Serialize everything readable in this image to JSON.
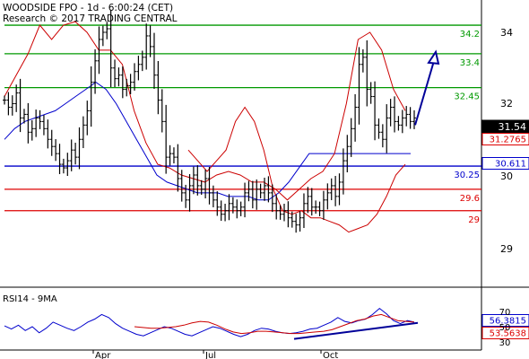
{
  "header": {
    "line1": "WOODSIDE FPO - 1d - 6:00:24 (CET)",
    "line2": "Research © 2017 TRADING CENTRAL"
  },
  "colors": {
    "candle": "#000000",
    "ma": "#0000cc",
    "bollinger": "#cc0000",
    "resistance": "#009900",
    "pivot": "#0000cc",
    "support": "#dd0000",
    "arrow": "#000099",
    "rsi": "#0000cc",
    "rsi_ma": "#cc0000"
  },
  "chart_data": [
    {
      "type": "line",
      "name": "price",
      "yaxis_ticks": [
        "34",
        "32",
        "30",
        "29"
      ],
      "ylim": [
        28.4,
        34.5
      ],
      "xaxis_ticks": [
        "Apr",
        "Jul",
        "Oct"
      ],
      "close": [
        32.1,
        31.9,
        32.0,
        32.3,
        31.6,
        31.7,
        31.2,
        31.3,
        31.6,
        31.5,
        31.3,
        31.0,
        30.8,
        30.6,
        30.3,
        30.2,
        30.4,
        30.7,
        30.5,
        31.0,
        31.4,
        31.8,
        32.6,
        33.2,
        33.8,
        34.0,
        34.1,
        33.0,
        32.7,
        32.8,
        32.4,
        32.5,
        32.6,
        32.9,
        33.1,
        33.3,
        33.9,
        33.6,
        32.8,
        32.1,
        31.5,
        30.5,
        30.6,
        30.5,
        29.9,
        29.5,
        29.3,
        29.7,
        30.0,
        29.7,
        29.6,
        29.9,
        29.5,
        29.3,
        29.1,
        28.9,
        29.0,
        29.2,
        29.1,
        29.0,
        29.1,
        29.5,
        29.6,
        29.3,
        29.6,
        29.5,
        29.7,
        29.5,
        29.2,
        29.0,
        28.9,
        29.0,
        28.8,
        28.7,
        28.6,
        28.8,
        29.2,
        29.4,
        29.1,
        29.1,
        29.0,
        29.3,
        29.5,
        29.7,
        29.4,
        29.8,
        30.4,
        30.8,
        31.3,
        31.9,
        33.1,
        33.3,
        32.4,
        32.2,
        31.4,
        31.2,
        31.0,
        31.6,
        31.9,
        31.5,
        31.4,
        31.6,
        31.7,
        31.5,
        31.6
      ],
      "series": [
        {
          "name": "",
          "values": [
            31.0,
            31.3,
            31.5,
            31.6,
            31.7,
            31.8,
            32.0,
            32.2,
            32.4,
            32.6,
            32.4,
            32.0,
            31.5,
            31.0,
            30.5,
            30.0,
            29.8,
            29.7,
            29.6,
            29.5,
            29.5,
            29.5,
            29.4,
            29.4,
            29.4,
            29.3,
            29.3,
            29.5,
            29.8,
            30.2,
            30.6,
            30.6,
            30.6,
            30.6,
            30.6,
            30.6,
            30.6,
            30.6,
            30.6,
            30.6,
            30.6
          ]
        },
        {
          "name": "",
          "values": [
            32.2,
            32.8,
            33.4,
            34.2,
            33.8,
            34.2,
            34.3,
            34.0,
            33.5,
            33.5,
            33.1,
            31.8,
            30.9,
            30.3,
            30.2,
            30.0,
            29.9,
            29.8,
            30.0,
            30.1,
            30.0,
            29.8,
            29.8,
            29.6,
            29.3,
            29.6,
            29.9,
            30.1,
            30.6,
            32.0,
            33.8,
            34.0,
            33.5,
            32.4,
            31.8
          ]
        },
        {
          "name": "",
          "values": [
            30.7,
            30.4,
            30.1,
            30.4,
            30.7,
            31.5,
            31.9,
            31.5,
            30.7,
            29.6,
            29.0,
            28.9,
            29.0,
            28.8,
            28.8,
            28.7,
            28.6,
            28.4,
            28.5,
            28.6,
            28.9,
            29.4,
            30.0,
            30.3
          ]
        }
      ],
      "levels": [
        {
          "label": "34.2",
          "value": 34.2,
          "kind": "resistance"
        },
        {
          "label": "33.4",
          "value": 33.4,
          "kind": "resistance"
        },
        {
          "label": "32.45",
          "value": 32.45,
          "kind": "resistance"
        },
        {
          "label": "30.25",
          "value": 30.25,
          "kind": "pivot"
        },
        {
          "label": "29.6",
          "value": 29.6,
          "kind": "support"
        },
        {
          "label": "29",
          "value": 29.0,
          "kind": "support"
        }
      ],
      "price_tags": [
        {
          "label": "31.54",
          "value": 31.54,
          "style": "dark"
        },
        {
          "label": "31.2765",
          "value": 31.2765,
          "style": "red"
        },
        {
          "label": "30.611",
          "value": 30.611,
          "style": "blue"
        }
      ],
      "forecast": {
        "from": 31.4,
        "to": 33.4
      }
    },
    {
      "type": "line",
      "title": "RSI14 - 9MA",
      "yaxis_ticks": [
        "70",
        "50",
        "30"
      ],
      "ylim": [
        22,
        80
      ],
      "series": [
        {
          "name": "",
          "values": [
            51,
            47,
            52,
            45,
            50,
            42,
            48,
            56,
            52,
            48,
            45,
            50,
            56,
            60,
            66,
            62,
            54,
            48,
            44,
            40,
            38,
            42,
            46,
            50,
            48,
            44,
            40,
            38,
            42,
            46,
            50,
            48,
            44,
            40,
            37,
            40,
            45,
            48,
            47,
            44,
            42,
            41,
            42,
            44,
            47,
            48,
            52,
            56,
            62,
            57,
            55,
            58,
            60,
            66,
            74,
            67,
            58,
            54,
            58,
            56
          ]
        },
        {
          "name": "",
          "values": [
            50,
            49,
            48,
            48,
            49,
            50,
            52,
            55,
            57,
            56,
            52,
            47,
            43,
            41,
            42,
            44,
            44,
            43,
            42,
            41,
            41,
            42,
            43,
            44,
            46,
            50,
            54,
            58,
            60,
            64,
            66,
            62,
            58,
            57,
            56
          ]
        }
      ],
      "price_tags": [
        {
          "label": "56.3815",
          "value": 56.3815,
          "style": "blue"
        },
        {
          "label": "53.5638",
          "value": 53.5638,
          "style": "red"
        }
      ],
      "trendline": [
        34,
        55
      ]
    }
  ]
}
